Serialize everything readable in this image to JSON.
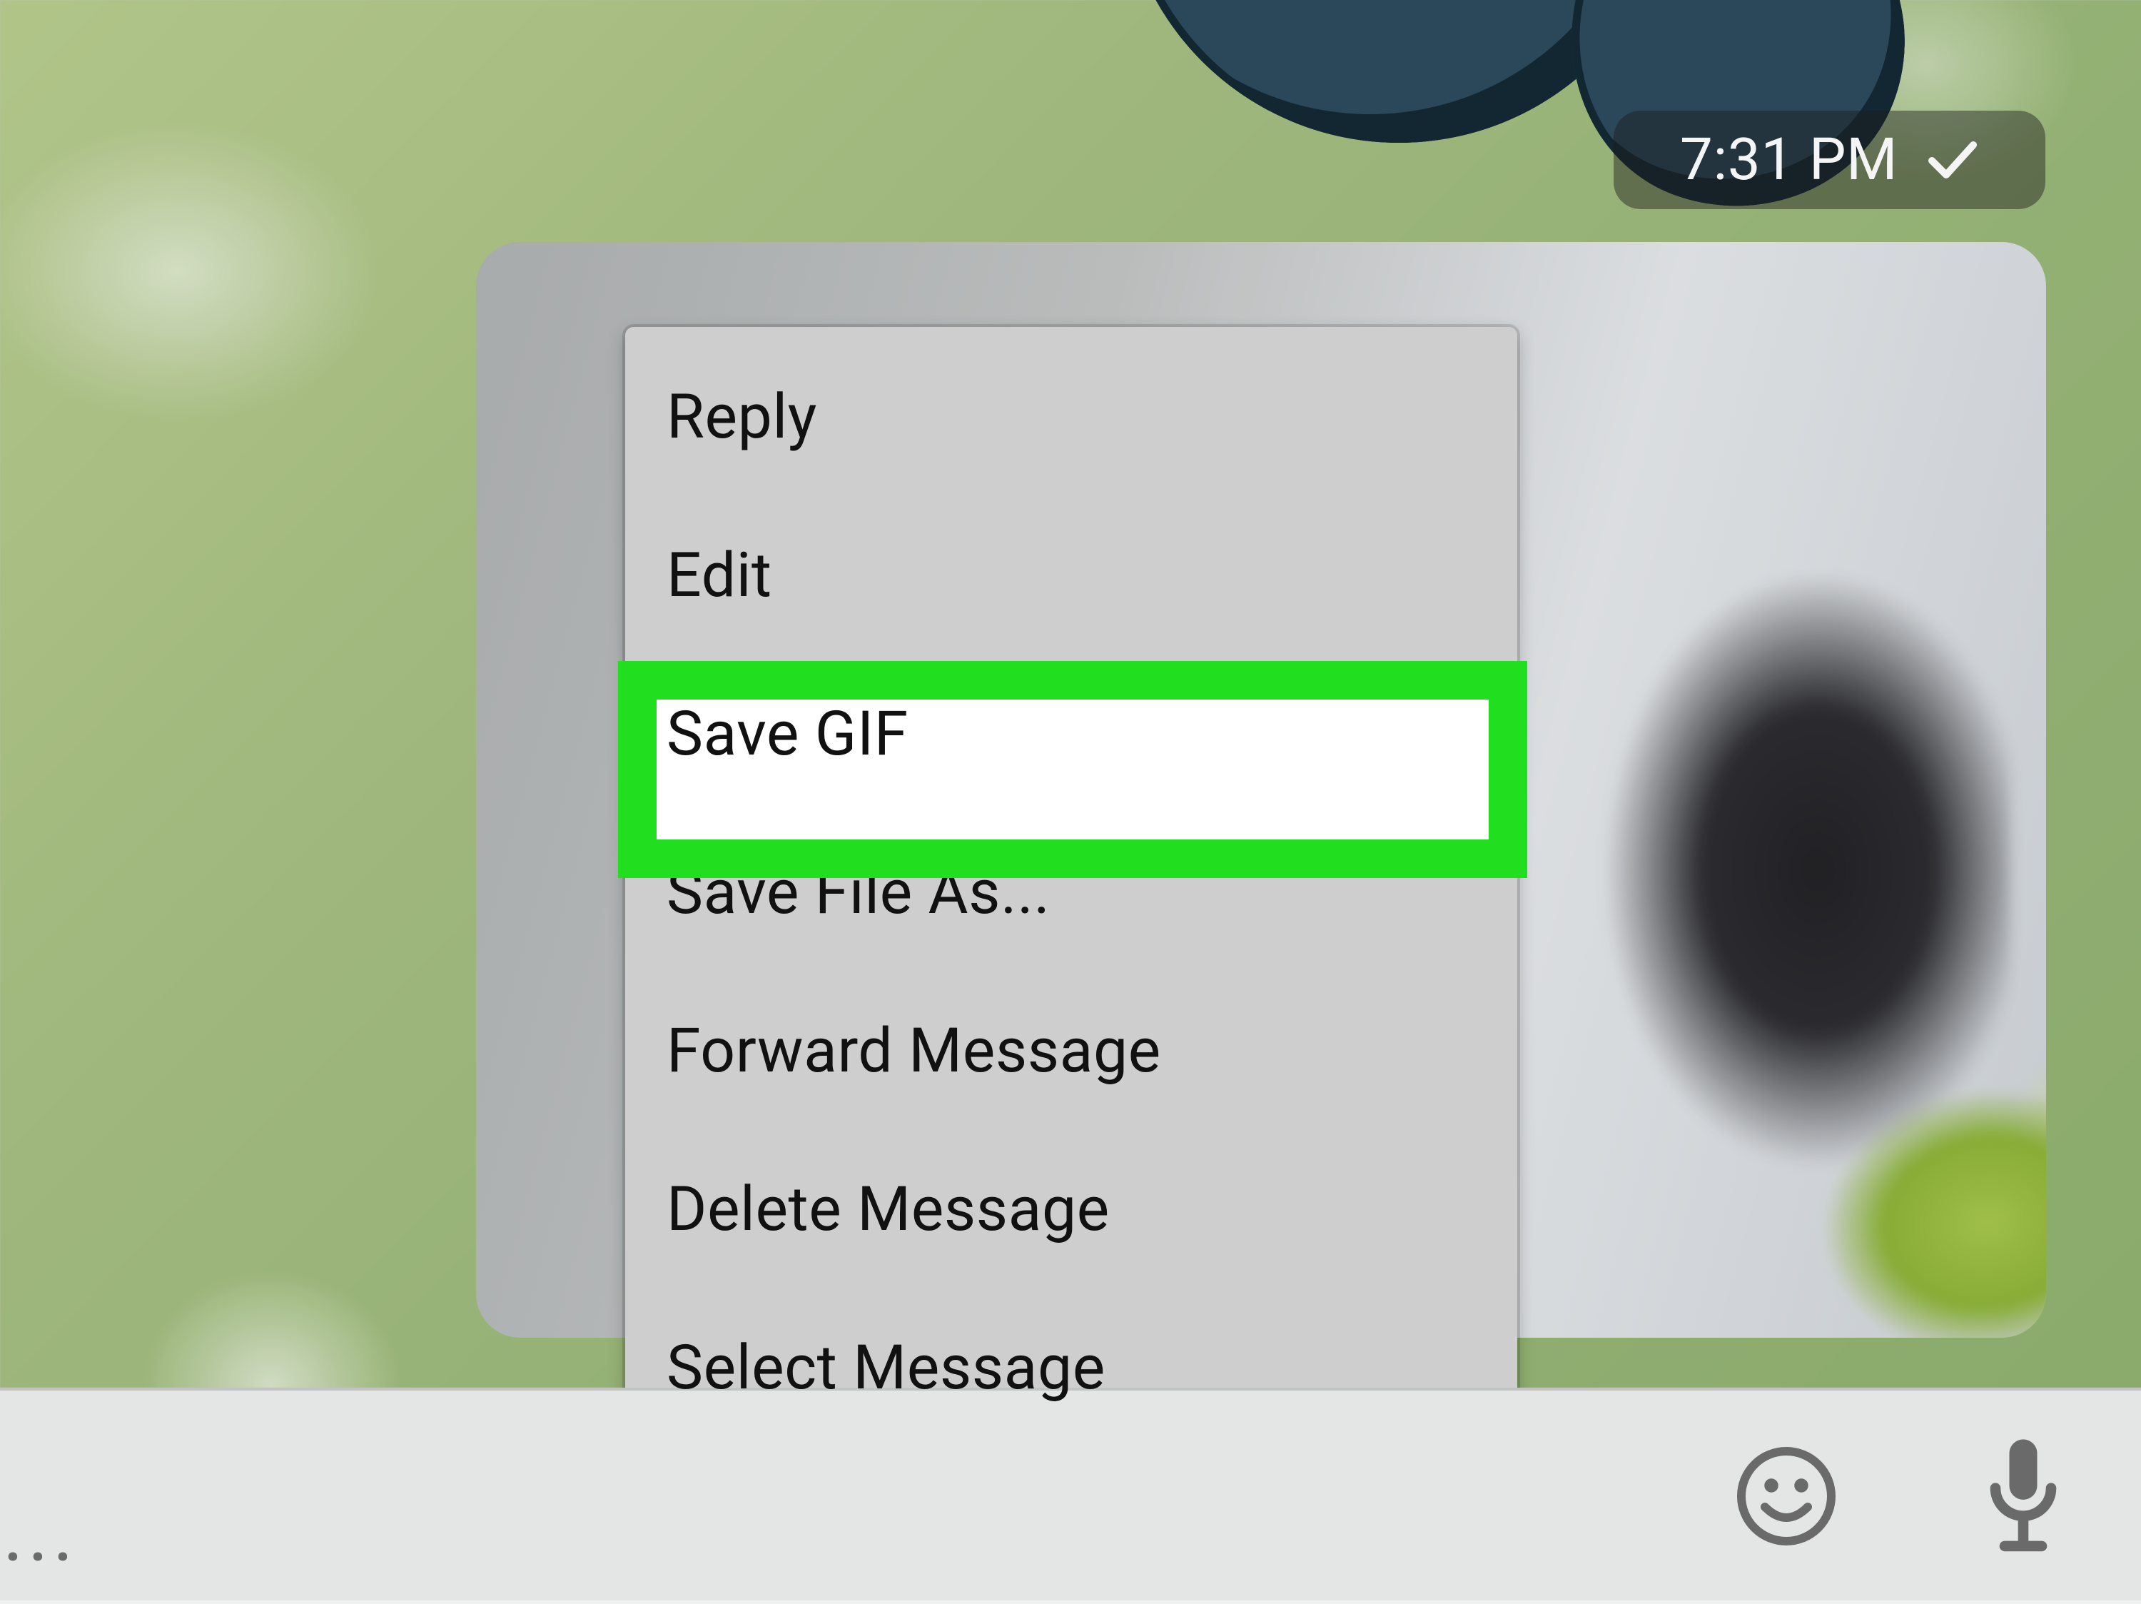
{
  "message": {
    "timestamp": "7:31 PM",
    "sent_check": "✓"
  },
  "context_menu": {
    "items": [
      {
        "label": "Reply",
        "name": "menu-item-reply",
        "highlighted": false
      },
      {
        "label": "Edit",
        "name": "menu-item-edit",
        "highlighted": false
      },
      {
        "label": "Save GIF",
        "name": "menu-item-save-gif",
        "highlighted": true
      },
      {
        "label": "Save File As...",
        "name": "menu-item-save-file-as",
        "highlighted": false
      },
      {
        "label": "Forward Message",
        "name": "menu-item-forward-message",
        "highlighted": false
      },
      {
        "label": "Delete Message",
        "name": "menu-item-delete-message",
        "highlighted": false
      },
      {
        "label": "Select Message",
        "name": "menu-item-select-message",
        "highlighted": false
      }
    ]
  },
  "input_bar": {
    "placeholder_ellipsis": "..."
  },
  "icons": {
    "emoji": "emoji-icon",
    "mic": "microphone-icon",
    "check": "sent-check-icon"
  },
  "colors": {
    "highlight_border": "#21de1f",
    "menu_bg": "#d7d7d7",
    "timestamp_bg": "rgba(30,30,30,0.45)"
  }
}
